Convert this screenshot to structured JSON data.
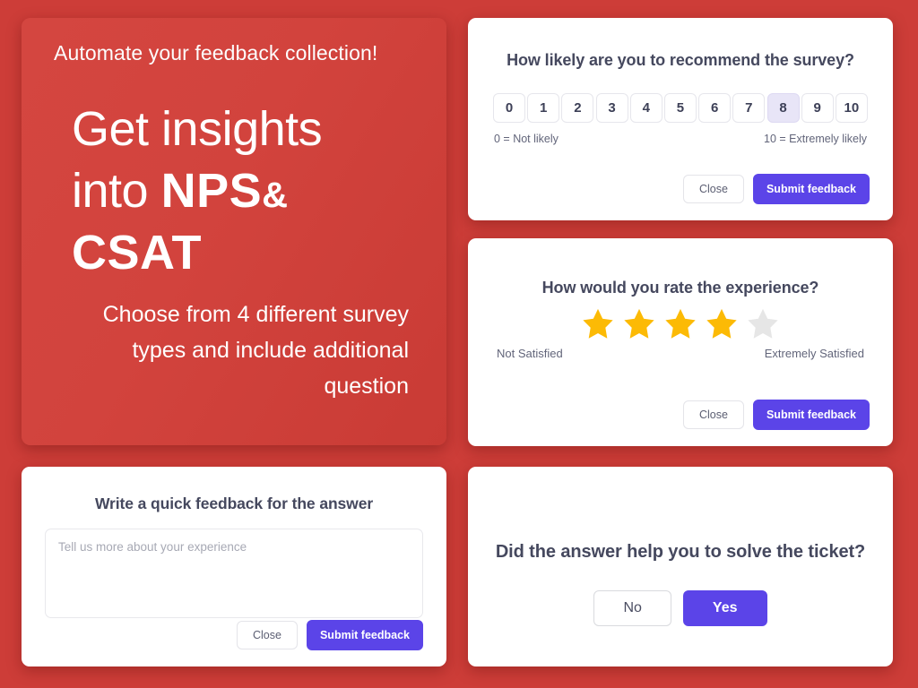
{
  "promo": {
    "kicker": "Automate your feedback collection!",
    "headline_line1": "Get insights",
    "headline_line2_prefix": "into ",
    "headline_line2_bold": "NPS",
    "headline_line2_amp": "&",
    "headline_line3_bold": "CSAT",
    "subtext": "Choose from 4 different survey types and include additional question",
    "background_color": "#cd3d38"
  },
  "nps_card": {
    "question": "How likely are you to recommend the survey?",
    "options": [
      "0",
      "1",
      "2",
      "3",
      "4",
      "5",
      "6",
      "7",
      "8",
      "9",
      "10"
    ],
    "selected_option": "8",
    "left_label": "0 = Not likely",
    "right_label": "10 = Extremely likely",
    "close_label": "Close",
    "submit_label": "Submit feedback"
  },
  "csat_card": {
    "question": "How would you rate the experience?",
    "stars_total": 5,
    "stars_filled": 4,
    "star_filled_color": "#fcba05",
    "star_empty_color": "#e6e6e6",
    "left_label": "Not Satisfied",
    "right_label": "Extremely Satisfied",
    "close_label": "Close",
    "submit_label": "Submit feedback"
  },
  "text_card": {
    "question": "Write a quick feedback for the answer",
    "textarea_value": "",
    "textarea_placeholder": "Tell us more about your experience",
    "close_label": "Close",
    "submit_label": "Submit feedback"
  },
  "yesno_card": {
    "question": "Did the answer help you to solve the ticket?",
    "no_label": "No",
    "yes_label": "Yes"
  },
  "theme": {
    "accent_purple": "#5b44e8",
    "selected_chip_bg": "#e8e5f7",
    "text_dark": "#45485e",
    "text_muted": "#62657a"
  }
}
